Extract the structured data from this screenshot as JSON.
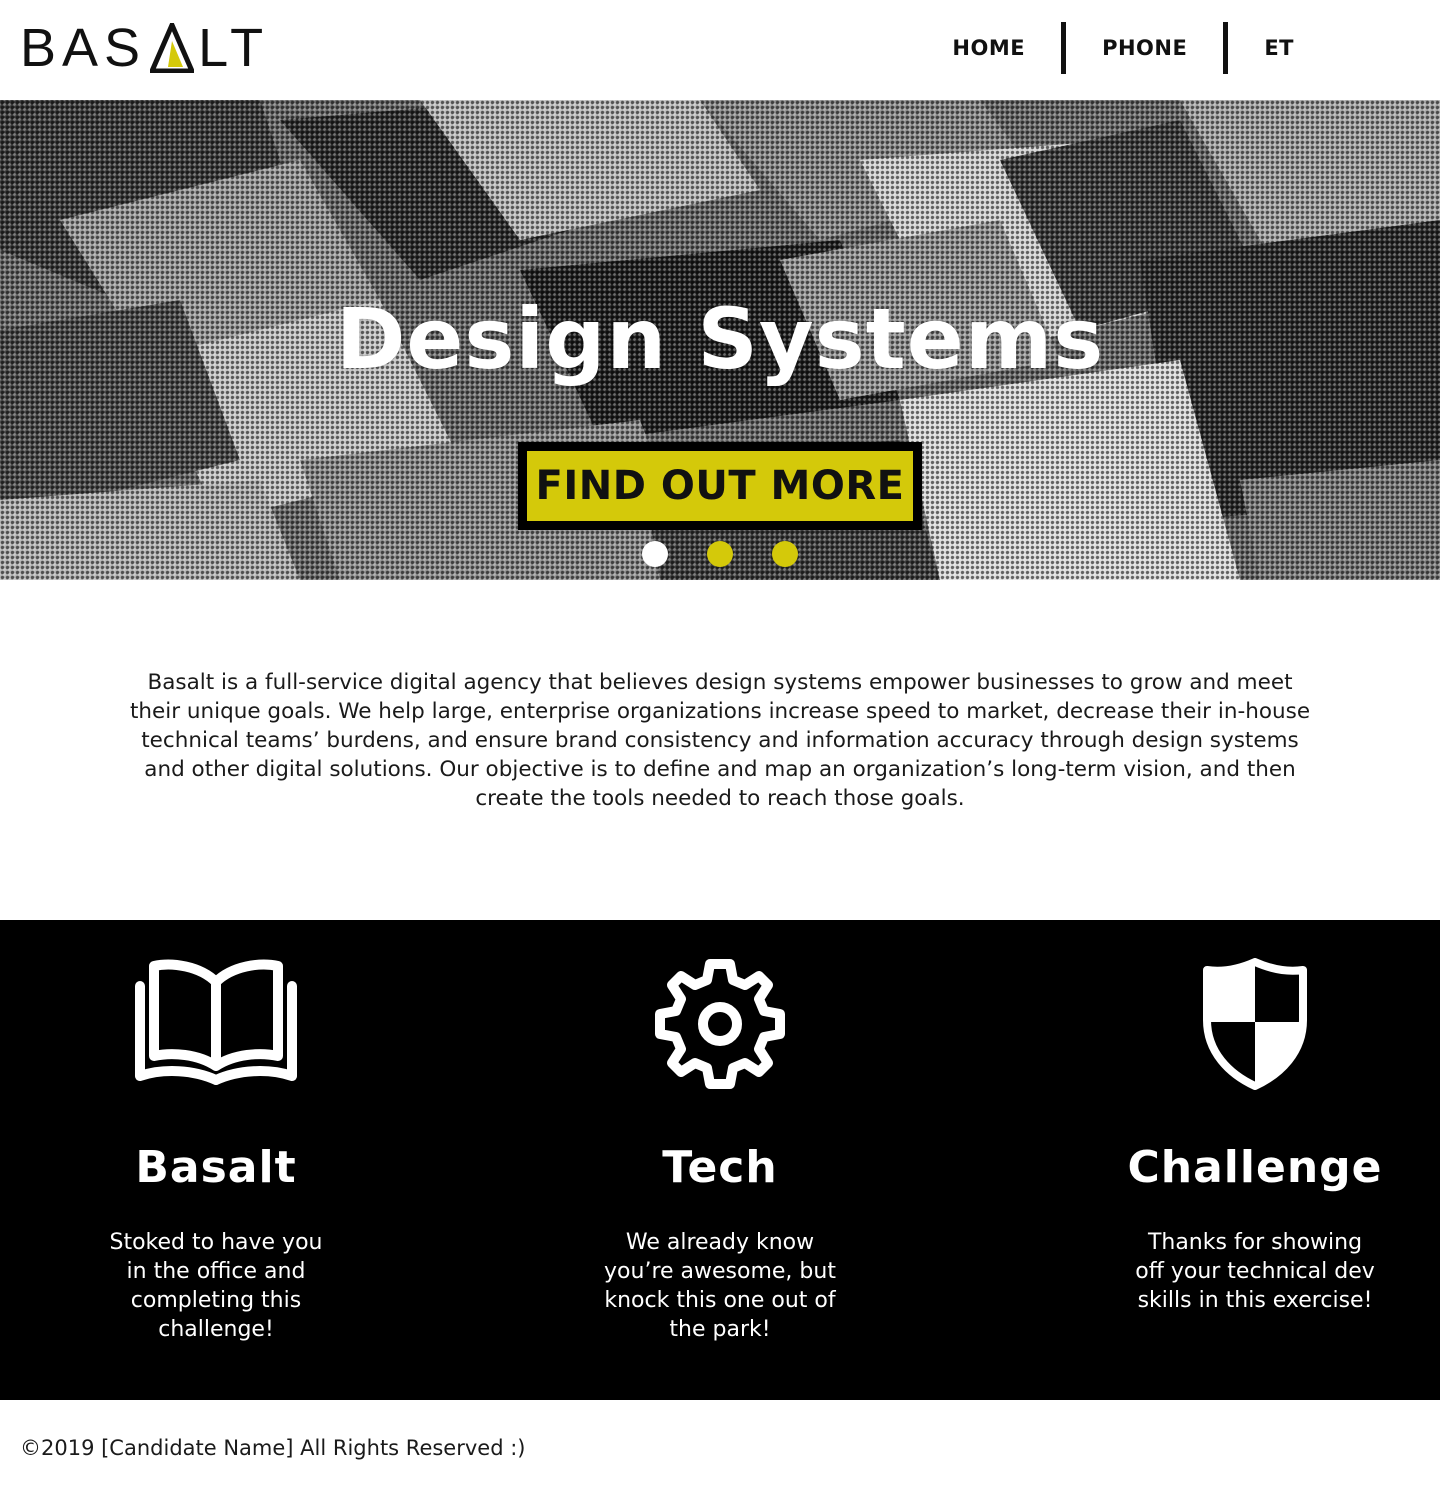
{
  "header": {
    "logo_text_left": "BAS",
    "logo_text_right": "LT",
    "nav": [
      {
        "label": "HOME"
      },
      {
        "label": "PHONE"
      },
      {
        "label": "ET"
      }
    ]
  },
  "hero": {
    "title": "Design Systems",
    "cta_label": "FIND OUT MORE",
    "carousel": {
      "slides": 3,
      "active": 1
    }
  },
  "about": {
    "text": "Basalt is a full-service digital agency that believes design systems empower businesses to grow and meet their unique goals. We help large, enterprise organizations increase speed to market, decrease their in-house technical teams’ burdens, and ensure brand consistency and information accuracy through design systems and other digital solutions. Our objective is to define and map an organization’s long-term vision, and then create the tools needed to reach those goals."
  },
  "features": [
    {
      "icon": "book-icon",
      "title": "Basalt",
      "text": "Stoked to have you in the office and completing this challenge!"
    },
    {
      "icon": "gear-icon",
      "title": "Tech",
      "text": "We already know you’re awesome, but knock this one out of the park!"
    },
    {
      "icon": "shield-icon",
      "title": "Challenge",
      "text": "Thanks for showing off your technical dev skills in this exercise!"
    }
  ],
  "footer": {
    "copyright": "©2019 [Candidate Name] All Rights Reserved :)"
  },
  "colors": {
    "accent": "#d4c90a",
    "dark": "#000000",
    "light": "#ffffff"
  }
}
